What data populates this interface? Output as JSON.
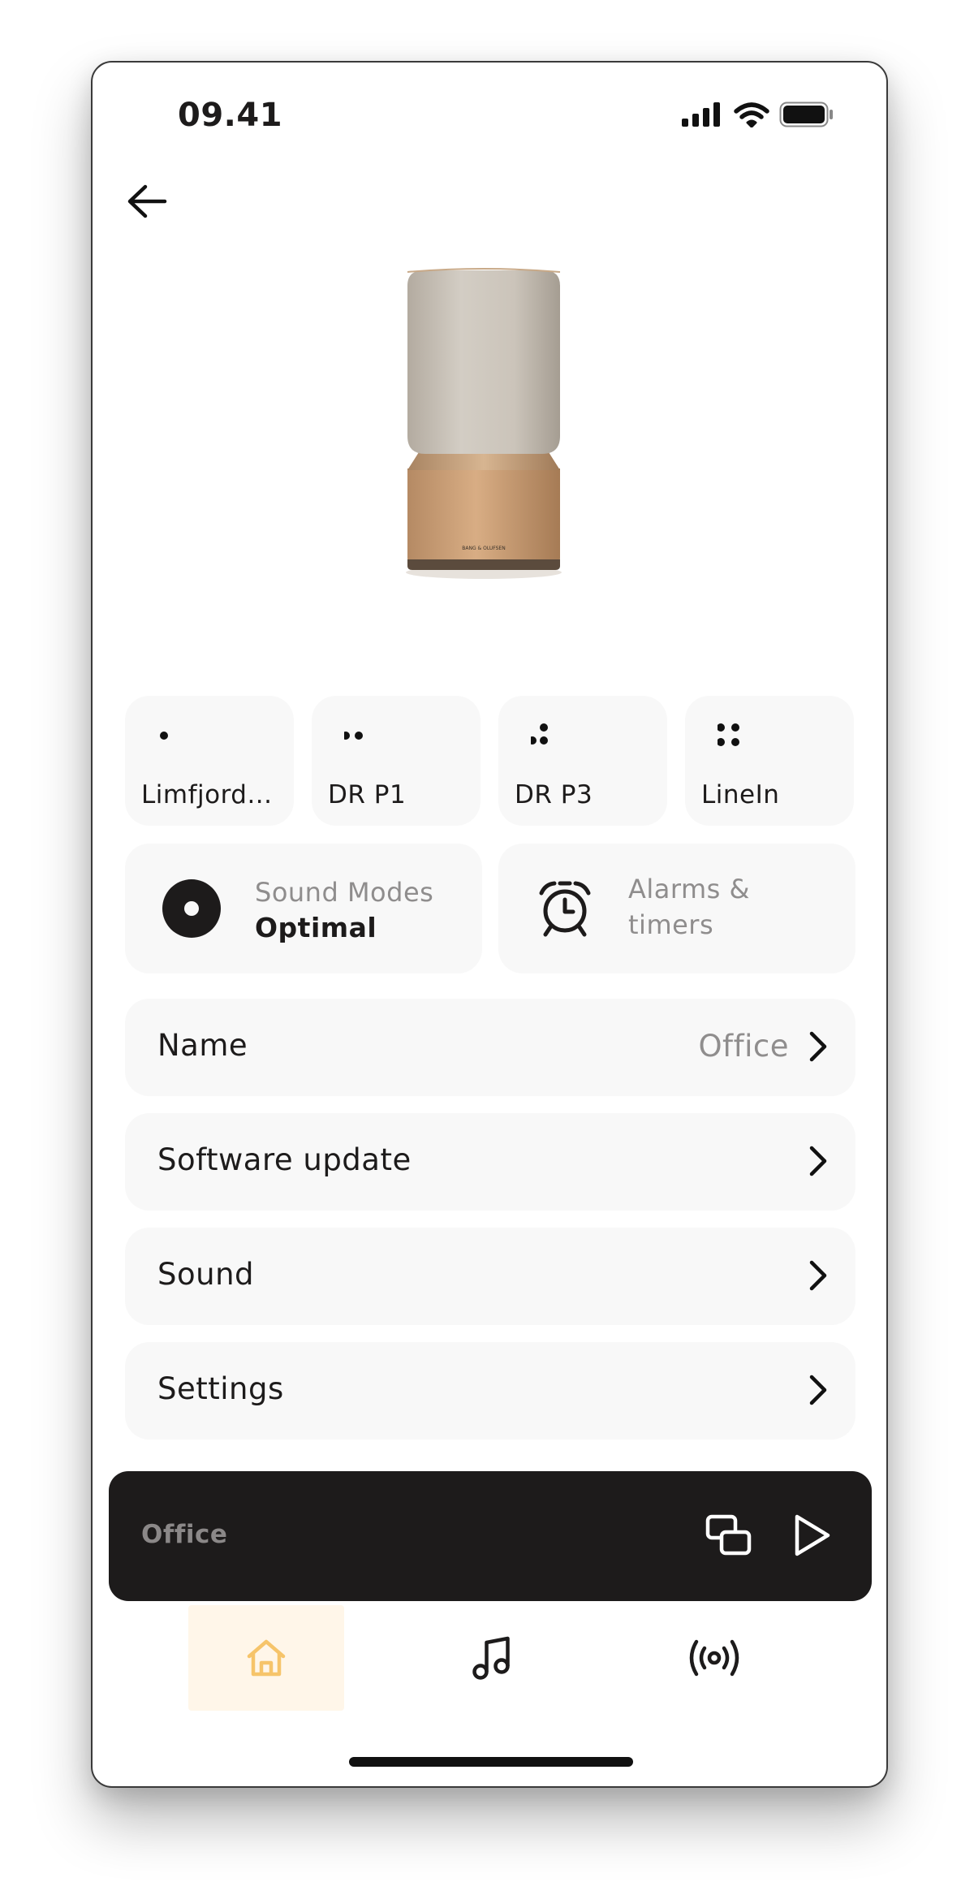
{
  "status_bar": {
    "time": "09.41",
    "signal_icon": "cellular-signal-icon",
    "wifi_icon": "wifi-icon",
    "battery_icon": "battery-icon"
  },
  "header": {
    "back_icon": "arrow-left-icon"
  },
  "product": {
    "image": "speaker-image"
  },
  "presets": [
    {
      "label": "Limfjord...",
      "icon": "one-dot-icon"
    },
    {
      "label": "DR P1",
      "icon": "two-dots-icon"
    },
    {
      "label": "DR P3",
      "icon": "three-dots-icon"
    },
    {
      "label": "LineIn",
      "icon": "four-dots-icon"
    }
  ],
  "sound_modes": {
    "title": "Sound Modes",
    "value": "Optimal",
    "icon": "disc-icon"
  },
  "alarms": {
    "title_line1": "Alarms &",
    "title_line2": "timers",
    "icon": "alarm-clock-icon"
  },
  "settings_rows": [
    {
      "label": "Name",
      "value": "Office"
    },
    {
      "label": "Software update",
      "value": ""
    },
    {
      "label": "Sound",
      "value": ""
    },
    {
      "label": "Settings",
      "value": ""
    }
  ],
  "player": {
    "room": "Office",
    "cast_icon": "multiroom-icon",
    "play_icon": "play-icon"
  },
  "bottom_nav": [
    {
      "name": "home",
      "icon": "home-icon",
      "active": true
    },
    {
      "name": "music",
      "icon": "music-note-icon",
      "active": false
    },
    {
      "name": "radio",
      "icon": "broadcast-icon",
      "active": false
    }
  ],
  "colors": {
    "accent": "#f6c46a",
    "accent_bg": "#fff6e9",
    "card_bg": "#f8f8f8",
    "player_bg": "#1d1b1b",
    "muted_text": "#8f8d8d"
  }
}
